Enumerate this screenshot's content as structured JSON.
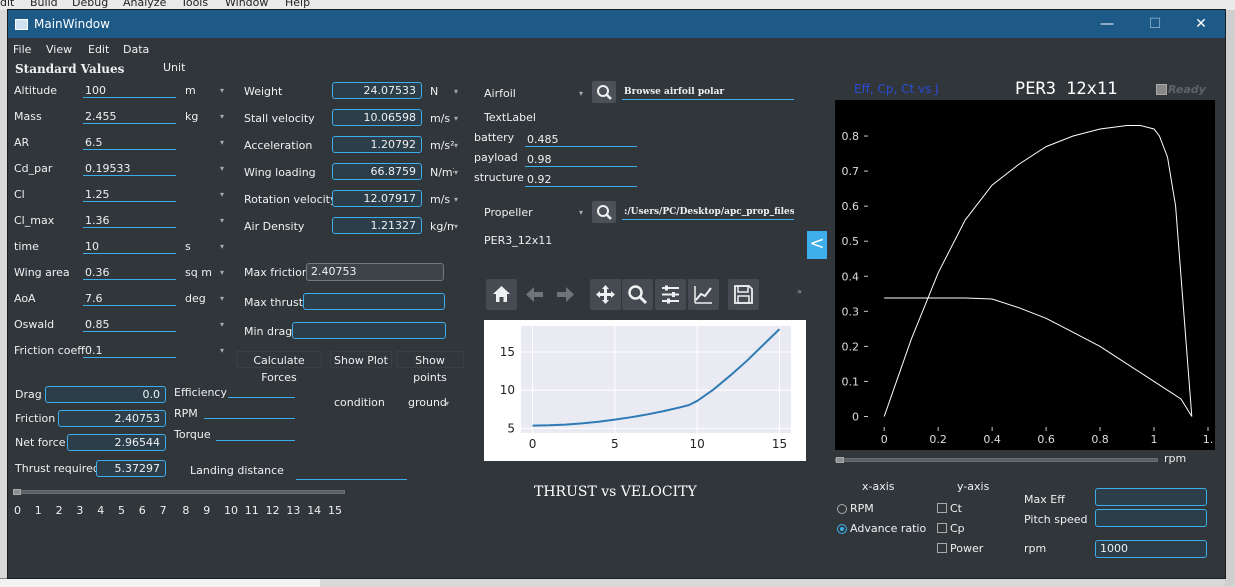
{
  "ide_menu": [
    "dit",
    "Build",
    "Debug",
    "Analyze",
    "Tools",
    "Window",
    "Help"
  ],
  "window": {
    "title": "MainWindow"
  },
  "menubar": [
    "File",
    "View",
    "Edit",
    "Data"
  ],
  "left": {
    "heading": "Standard Values",
    "unit_header": "Unit",
    "params": [
      {
        "label": "Altitude",
        "value": "100",
        "unit": "m"
      },
      {
        "label": "Mass",
        "value": "2.455",
        "unit": "kg"
      },
      {
        "label": "AR",
        "value": "6.5",
        "unit": ""
      },
      {
        "label": "Cd_par",
        "value": "0.19533",
        "unit": ""
      },
      {
        "label": "Cl",
        "value": "1.25",
        "unit": ""
      },
      {
        "label": "Cl_max",
        "value": "1.36",
        "unit": ""
      },
      {
        "label": "time",
        "value": "10",
        "unit": "s"
      },
      {
        "label": "Wing area",
        "value": "0.36",
        "unit": "sq m"
      },
      {
        "label": "AoA",
        "value": "7.6",
        "unit": "deg"
      },
      {
        "label": "Oswald",
        "value": "0.85",
        "unit": ""
      },
      {
        "label": "Friction coeff",
        "value": "0.1",
        "unit": ""
      }
    ]
  },
  "middle": {
    "results": [
      {
        "label": "Weight",
        "value": "24.07533",
        "unit": "N"
      },
      {
        "label": "Stall velocity",
        "value": "10.06598",
        "unit": "m/s"
      },
      {
        "label": "Acceleration",
        "value": "1.20792",
        "unit": "m/s²"
      },
      {
        "label": "Wing loading",
        "value": "66.8759",
        "unit": "N/m²"
      },
      {
        "label": "Rotation velocity",
        "value": "12.07917",
        "unit": "m/s"
      },
      {
        "label": "Air Density",
        "value": "1.21327",
        "unit": "kg/m³"
      }
    ],
    "max_friction_label": "Max friction",
    "max_friction_value": "2.40753",
    "max_thrust_label": "Max thrust",
    "max_thrust_value": "",
    "min_drag_label": "Min drag",
    "min_drag_value": "",
    "calc_button": "Calculate Forces",
    "show_plot_button": "Show Plot",
    "show_points_button": "Show points"
  },
  "bottom_left": {
    "drag_label": "Drag",
    "drag_value": "0.0",
    "friction_label": "Friction",
    "friction_value": "2.40753",
    "net_force_label": "Net force",
    "net_force_value": "2.96544",
    "thrust_required_label": "Thrust required",
    "thrust_required_value": "5.37297",
    "efficiency_label": "Efficiency",
    "rpm_label": "RPM",
    "torque_label": "Torque",
    "condition_label": "condition",
    "condition_value": "ground",
    "landing_distance_label": "Landing distance",
    "slider_ticks": [
      "0",
      "1",
      "2",
      "3",
      "4",
      "5",
      "6",
      "7",
      "8",
      "9",
      "10",
      "11",
      "12",
      "13",
      "14",
      "15"
    ],
    "slider_value": 0
  },
  "airfoil": {
    "label": "Airfoil",
    "browse_text": "Browse airfoil polar",
    "textlabel": "TextLabel",
    "fractions": [
      {
        "label": "battery",
        "value": "0.485"
      },
      {
        "label": "payload",
        "value": "0.98"
      },
      {
        "label": "structure",
        "value": "0.92"
      }
    ]
  },
  "propeller": {
    "label": "Propeller",
    "path": ":/Users/PC/Desktop/apc_prop_files",
    "name": "PER3_12x11",
    "collapse_glyph": "<"
  },
  "toolbar": {
    "icons": [
      "home-icon",
      "back-arrow-icon",
      "forward-arrow-icon",
      "pan-icon",
      "zoom-icon",
      "configure-icon",
      "edit-axes-icon",
      "save-icon"
    ],
    "overflow": "»"
  },
  "thrust_chart": {
    "caption": "THRUST vs VELOCITY",
    "chart_data": {
      "type": "line",
      "x": [
        0,
        1,
        2,
        3,
        4,
        5,
        6,
        7,
        8,
        9,
        9.5,
        10,
        11,
        12,
        13,
        14,
        15
      ],
      "y": [
        5.37,
        5.41,
        5.5,
        5.66,
        5.88,
        6.15,
        6.47,
        6.85,
        7.28,
        7.78,
        8.05,
        8.6,
        10.1,
        11.9,
        13.8,
        15.9,
        18.0
      ],
      "xticks": [
        "0",
        "5",
        "10",
        "15"
      ],
      "yticks": [
        "5",
        "10",
        "15"
      ],
      "xlim": [
        -0.7,
        15.7
      ],
      "ylim": [
        4.4,
        18.4
      ],
      "grid": true,
      "series_color": "#2f7bb5",
      "background": "#eaeaf2"
    }
  },
  "eff_chart": {
    "link_text": "Eff, Cp, Ct vs J",
    "title": "PER3 12x11",
    "ready_text": "Ready",
    "chart_data": {
      "type": "line",
      "xticks": [
        "0",
        "0.2",
        "0.4",
        "0.6",
        "0.8",
        "1",
        "1."
      ],
      "yticks": [
        "0",
        "0.1",
        "0.2",
        "0.3",
        "0.4",
        "0.5",
        "0.6",
        "0.7",
        "0.8"
      ],
      "xlim": [
        -0.06,
        1.2
      ],
      "ylim": [
        -0.03,
        0.86
      ],
      "series": [
        {
          "x": [
            0.0,
            0.05,
            0.1,
            0.2,
            0.3,
            0.4,
            0.5,
            0.6,
            0.7,
            0.8,
            0.9,
            0.95,
            1.0,
            1.02,
            1.05,
            1.08,
            1.1,
            1.12,
            1.14
          ],
          "y": [
            0.0,
            0.11,
            0.22,
            0.41,
            0.56,
            0.66,
            0.72,
            0.77,
            0.8,
            0.82,
            0.83,
            0.83,
            0.82,
            0.8,
            0.74,
            0.6,
            0.4,
            0.2,
            0.0
          ],
          "color": "#ffffff"
        },
        {
          "x": [
            0.0,
            0.1,
            0.2,
            0.3,
            0.4,
            0.5,
            0.6,
            0.7,
            0.8,
            0.9,
            1.0,
            1.1,
            1.14
          ],
          "y": [
            0.338,
            0.338,
            0.338,
            0.338,
            0.335,
            0.31,
            0.28,
            0.24,
            0.2,
            0.15,
            0.1,
            0.05,
            0.0
          ],
          "color": "#ffffff"
        }
      ]
    },
    "slider_label": "rpm",
    "slider_value": 0
  },
  "axes_selector": {
    "x_axis_label": "x-axis",
    "y_axis_label": "y-axis",
    "x_options": [
      {
        "label": "RPM",
        "checked": false
      },
      {
        "label": "Advance ratio",
        "checked": true
      }
    ],
    "y_options": [
      {
        "label": "Ct",
        "checked": false
      },
      {
        "label": "Cp",
        "checked": false
      },
      {
        "label": "Power",
        "checked": false
      }
    ],
    "max_eff_label": "Max Eff",
    "max_eff_value": "",
    "pitch_speed_label": "Pitch speed",
    "pitch_speed_value": "",
    "rpm_label": "rpm",
    "rpm_value": "1000"
  }
}
